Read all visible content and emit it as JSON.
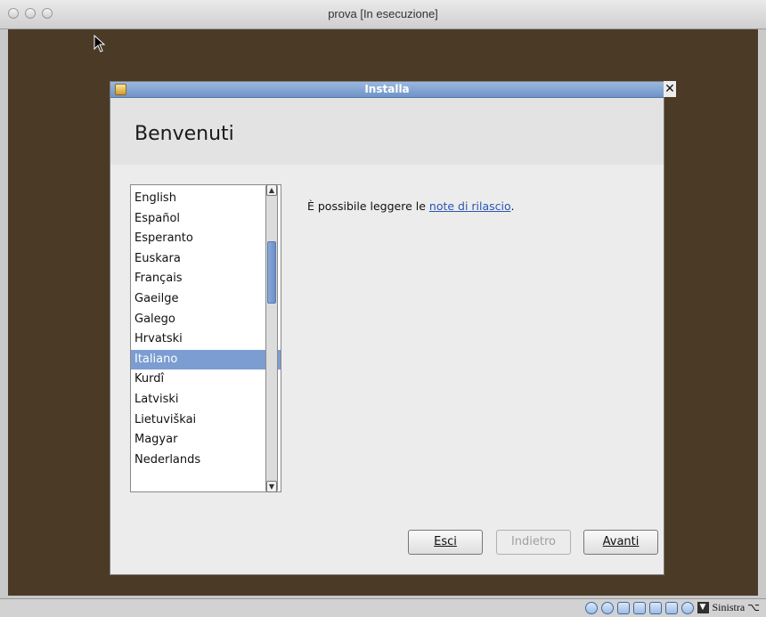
{
  "host_window": {
    "title": "prova [In esecuzione]"
  },
  "dialog": {
    "title": "Installa",
    "close_glyph": "✕",
    "page_title": "Benvenuti",
    "languages": [
      "English",
      "Español",
      "Esperanto",
      "Euskara",
      "Français",
      "Gaeilge",
      "Galego",
      "Hrvatski",
      "Italiano",
      "Kurdî",
      "Latviski",
      "Lietuviškai",
      "Magyar",
      "Nederlands"
    ],
    "selected_language": "Italiano",
    "info": {
      "prefix": "È possibile leggere le ",
      "link": "note di rilascio",
      "suffix": "."
    },
    "buttons": {
      "quit": "Esci",
      "back": "Indietro",
      "forward": "Avanti"
    }
  },
  "statusbar": {
    "host_key": "Sinistra ⌥"
  },
  "colors": {
    "vm_background": "#4b3b26",
    "dialog_titlebar": "#7a9dd0",
    "selection": "#7b9dd1",
    "link": "#2a56b5"
  }
}
